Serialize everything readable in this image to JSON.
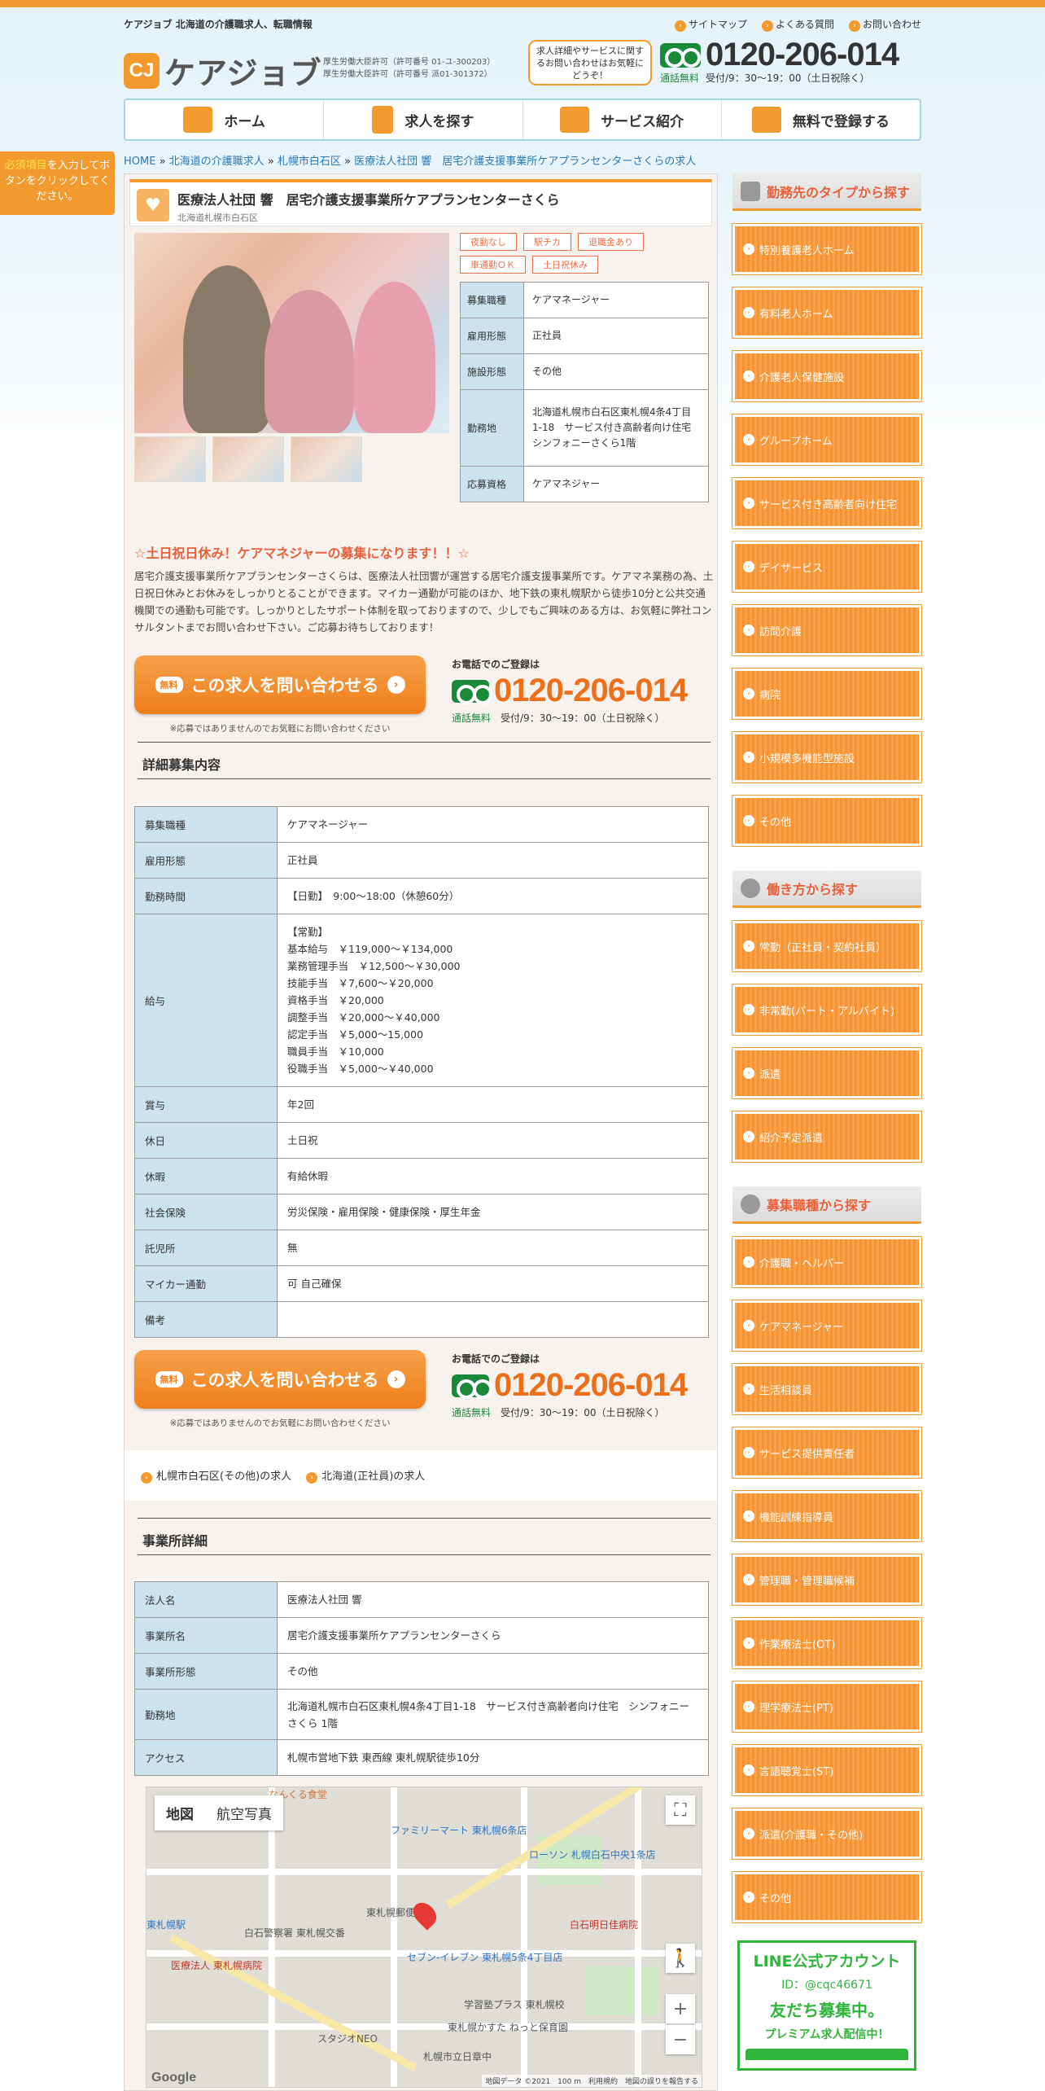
{
  "header": {
    "tagline": "ケアジョブ 北海道の介護職求人、転職情報",
    "links": [
      "サイトマップ",
      "よくある質問",
      "お問い合わせ"
    ],
    "logo_mark": "CJ",
    "logo_text": "ケアジョブ",
    "license_1": "厚生労働大臣許可（許可番号 01-ユ-300203）",
    "license_2": "厚生労働大臣許可（許可番号 派01-301372）",
    "bubble": "求人詳細やサービスに関するお問い合わせはお気軽にどうぞ！",
    "phone": "0120-206-014",
    "phone_free": "通話無料",
    "phone_hours": "受付/9：30～19：00（土日祝除く）"
  },
  "nav": [
    "ホーム",
    "求人を探す",
    "サービス紹介",
    "無料で登録する"
  ],
  "breadcrumb": {
    "items": [
      "HOME",
      "北海道の介護職求人",
      "札幌市白石区",
      "医療法人社団 響",
      "居宅介護支援事業所ケアプランセンターさくらの求人"
    ]
  },
  "side_note": {
    "highlight": "必須項目",
    "text": "を入力してボタンをクリックしてください。"
  },
  "job": {
    "title": "医療法人社団 響　居宅介護支援事業所ケアプランセンターさくら",
    "location": "北海道札幌市白石区",
    "tags": [
      "夜勤なし",
      "駅チカ",
      "退職金あり",
      "車通勤ＯＫ",
      "土日祝休み"
    ],
    "summary": [
      {
        "label": "募集職種",
        "value": "ケアマネージャー"
      },
      {
        "label": "雇用形態",
        "value": "正社員"
      },
      {
        "label": "施設形態",
        "value": "その他"
      },
      {
        "label": "勤務地",
        "value": "北海道札幌市白石区東札幌4条4丁目1-18　サービス付き高齢者向け住宅　シンフォニーさくら1階"
      },
      {
        "label": "応募資格",
        "value": "ケアマネジャー"
      }
    ],
    "catch": "☆土日祝日休み！ケアマネジャーの募集になります！！☆",
    "intro": "居宅介護支援事業所ケアプランセンターさくらは、医療法人社団響が運営する居宅介護支援事業所です。ケアマネ業務の為、土日祝日休みとお休みをしっかりとることができます。マイカー通勤が可能のほか、地下鉄の東札幌駅から徒歩10分と公共交通機関での通勤も可能です。しっかりとしたサポート体制を取っておりますので、少しでもご興味のある方は、お気軽に弊社コンサルタントまでお問い合わせ下さい。ご応募お待ちしております！"
  },
  "cta": {
    "free": "無料",
    "label": "この求人を問い合わせる",
    "note": "※応募ではありませんのでお気軽にお問い合わせください",
    "tel_label": "お電話でのご登録は",
    "phone": "0120-206-014",
    "phone_free": "通話無料",
    "hours": "受付/9：30～19：00（土日祝除く）"
  },
  "details": {
    "title": "詳細募集内容",
    "rows": [
      {
        "label": "募集職種",
        "value": "ケアマネージャー"
      },
      {
        "label": "雇用形態",
        "value": "正社員"
      },
      {
        "label": "勤務時間",
        "value": "【日勤】　9:00～18:00（休憩60分）"
      },
      {
        "label": "給与",
        "value": "【常勤】\n基本給与　￥119,000～￥134,000\n業務管理手当　￥12,500～￥30,000\n技能手当　￥7,600～￥20,000\n資格手当　￥20,000\n調整手当　￥20,000～￥40,000\n認定手当　￥5,000～15,000\n職員手当　￥10,000\n役職手当　￥5,000～￥40,000"
      },
      {
        "label": "賞与",
        "value": "年2回"
      },
      {
        "label": "休日",
        "value": "土日祝"
      },
      {
        "label": "休暇",
        "value": "有給休暇"
      },
      {
        "label": "社会保険",
        "value": "労災保険・雇用保険・健康保険・厚生年金"
      },
      {
        "label": "託児所",
        "value": "無"
      },
      {
        "label": "マイカー通勤",
        "value": "可 自己確保"
      },
      {
        "label": "備考",
        "value": ""
      }
    ]
  },
  "related": [
    "札幌市白石区(その他)の求人",
    "北海道(正社員)の求人"
  ],
  "office": {
    "title": "事業所詳細",
    "rows": [
      {
        "label": "法人名",
        "value": "医療法人社団 響"
      },
      {
        "label": "事業所名",
        "value": "居宅介護支援事業所ケアプランセンターさくら"
      },
      {
        "label": "事業所形態",
        "value": "その他"
      },
      {
        "label": "勤務地",
        "value": "北海道札幌市白石区東札幌4条4丁目1-18　サービス付き高齢者向け住宅　シンフォニーさくら 1階"
      },
      {
        "label": "アクセス",
        "value": "札幌市営地下鉄 東西線 東札幌駅徒歩10分"
      }
    ]
  },
  "map": {
    "tab_map": "地図",
    "tab_satellite": "航空写真",
    "labels": [
      "ファミリーマート 東札幌6条店",
      "ローソン 札幌白石中央1条店",
      "白石明日佳病院",
      "セブン-イレブン 東札幌5条4丁目店",
      "医療法人 東札幌病院",
      "白石警察署 東札幌交番",
      "東札幌郵便局",
      "東札幌駅",
      "学習塾プラス 東札幌校",
      "スタジオNEO",
      "なんくる食堂",
      "東札幌かすた ねっと保育園",
      "札幌市立日章中"
    ],
    "footer": "地図データ ©2021　100 m　利用規約　地図の誤りを報告する",
    "google": "Google"
  },
  "sidebar": {
    "sections": [
      {
        "title": "勤務先のタイプから探す",
        "items": [
          "特別養護老人ホーム",
          "有料老人ホーム",
          "介護老人保健施設",
          "グループホーム",
          "サービス付き高齢者向け住宅",
          "デイサービス",
          "訪問介護",
          "病院",
          "小規模多機能型施設",
          "その他"
        ]
      },
      {
        "title": "働き方から探す",
        "items": [
          "常勤（正社員・契約社員）",
          "非常勤(パート・アルバイト)",
          "派遣",
          "紹介予定派遣"
        ]
      },
      {
        "title": "募集職種から探す",
        "items": [
          "介護職・ヘルパー",
          "ケアマネージャー",
          "生活相談員",
          "サービス提供責任者",
          "機能訓練指導員",
          "管理職・管理職候補",
          "作業療法士(OT)",
          "理学療法士(PT)",
          "言語聴覚士(ST)",
          "派遣(介護職・その他)",
          "その他"
        ]
      }
    ],
    "line": {
      "title": "LINE公式アカウント",
      "id": "ID：@cqc46671",
      "friends": "友だち募集中。",
      "premium": "プレミアム求人配信中！"
    }
  }
}
